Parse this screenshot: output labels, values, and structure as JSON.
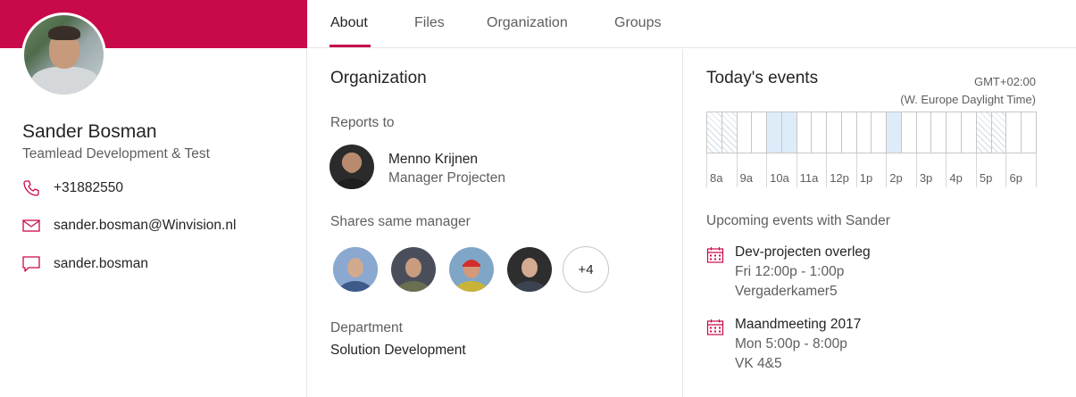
{
  "profile": {
    "name": "Sander Bosman",
    "title": "Teamlead Development & Test",
    "phone": "+31882550",
    "email": "sander.bosman@Winvision.nl",
    "chat": "sander.bosman",
    "accent_color": "#c8094a"
  },
  "tabs": [
    {
      "label": "About",
      "active": true
    },
    {
      "label": "Files",
      "active": false
    },
    {
      "label": "Organization",
      "active": false
    },
    {
      "label": "Groups",
      "active": false
    }
  ],
  "organization": {
    "heading": "Organization",
    "reports_to_label": "Reports to",
    "manager": {
      "name": "Menno Krijnen",
      "role": "Manager Projecten"
    },
    "shares_manager_label": "Shares same manager",
    "more_count": "+4",
    "department_label": "Department",
    "department": "Solution Development"
  },
  "events": {
    "heading": "Today's events",
    "timezone_offset": "GMT+02:00",
    "timezone_name": "(W. Europe Daylight Time)",
    "hours": [
      "8a",
      "9a",
      "10a",
      "11a",
      "12p",
      "1p",
      "2p",
      "3p",
      "4p",
      "5p",
      "6p"
    ],
    "slot_states": [
      "oof",
      "oof",
      "free",
      "free",
      "busy",
      "busy",
      "free",
      "free",
      "free",
      "free",
      "free",
      "free",
      "busy",
      "free",
      "free",
      "free",
      "free",
      "free",
      "oof",
      "oof",
      "free",
      "free"
    ],
    "upcoming_label": "Upcoming events with Sander",
    "upcoming": [
      {
        "name": "Dev-projecten overleg",
        "time": "Fri 12:00p - 1:00p",
        "location": "Vergaderkamer5"
      },
      {
        "name": "Maandmeeting 2017",
        "time": "Mon 5:00p - 8:00p",
        "location": "VK 4&5"
      }
    ]
  }
}
